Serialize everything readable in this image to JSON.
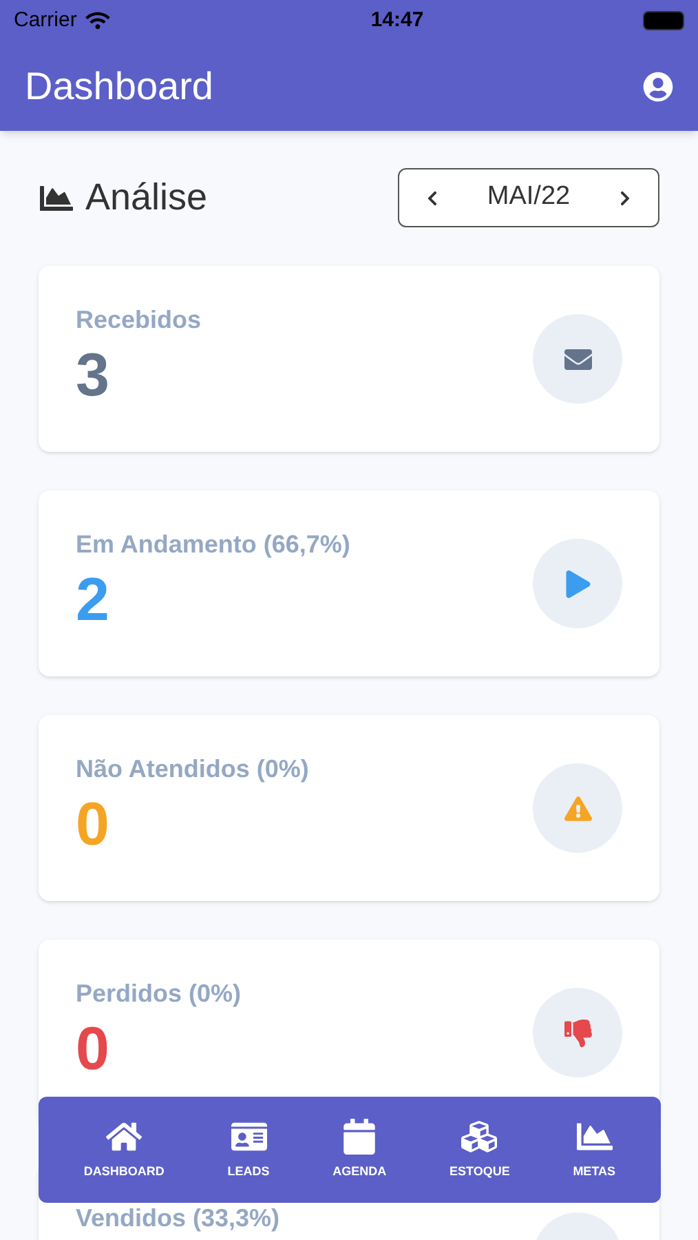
{
  "status_bar": {
    "carrier": "Carrier",
    "time": "14:47"
  },
  "app_bar": {
    "title": "Dashboard"
  },
  "section": {
    "title": "Análise",
    "period": "MAI/22"
  },
  "cards": [
    {
      "label": "Recebidos",
      "value": "3",
      "color": "#64748b",
      "kind": "envelope"
    },
    {
      "label": "Em Andamento (66,7%)",
      "value": "2",
      "color": "#3b9cf0",
      "kind": "play"
    },
    {
      "label": "Não Atendidos (0%)",
      "value": "0",
      "color": "#f5a524",
      "kind": "warning"
    },
    {
      "label": "Perdidos (0%)",
      "value": "0",
      "color": "#e5484d",
      "kind": "thumbs-down"
    },
    {
      "label": "Vendidos (33,3%)",
      "kind": "none"
    }
  ],
  "nav": [
    {
      "label": "DASHBOARD",
      "kind": "home"
    },
    {
      "label": "LEADS",
      "kind": "card"
    },
    {
      "label": "AGENDA",
      "kind": "calendar"
    },
    {
      "label": "ESTOQUE",
      "kind": "boxes"
    },
    {
      "label": "METAS",
      "kind": "chart"
    }
  ]
}
